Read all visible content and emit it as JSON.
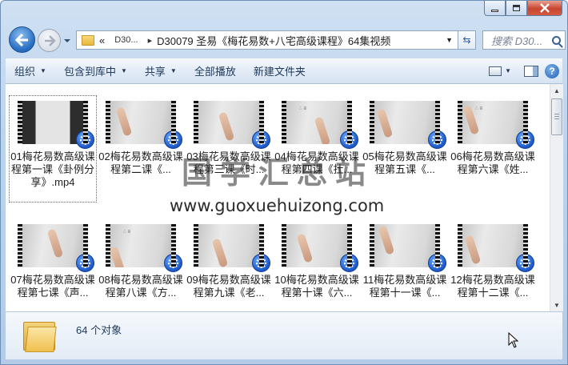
{
  "address": {
    "overflow": "«",
    "crumbs": [
      "D30...",
      "D30079 圣易《梅花易数+八宅高级课程》64集视频"
    ]
  },
  "search": {
    "placeholder": "搜索 D30..."
  },
  "toolbar": {
    "organize": "组织",
    "include_library": "包含到库中",
    "share": "共享",
    "play_all": "全部播放",
    "new_folder": "新建文件夹"
  },
  "files": [
    {
      "name": "01梅花易数高级课程第一课《卦例分享》.mp4",
      "label": "01梅花易数高级课程第一课《卦例分享》.mp4"
    },
    {
      "name": "02",
      "label": "02梅花易数高级课程第二课《..."
    },
    {
      "name": "03",
      "label": "03梅花易数高级课程第三课《时..."
    },
    {
      "name": "04",
      "label": "04梅花易数高级课程第四课《扗..."
    },
    {
      "name": "05",
      "label": "05梅花易数高级课程第五课《..."
    },
    {
      "name": "06",
      "label": "06梅花易数高级课程第六课《姓..."
    },
    {
      "name": "07",
      "label": "07梅花易数高级课程第七课《声..."
    },
    {
      "name": "08",
      "label": "08梅花易数高级课程第八课《方..."
    },
    {
      "name": "09",
      "label": "09梅花易数高级课程第九课《老..."
    },
    {
      "name": "10",
      "label": "10梅花易数高级课程第十课《六..."
    },
    {
      "name": "11",
      "label": "11梅花易数高级课程第十一课《..."
    },
    {
      "name": "12",
      "label": "12梅花易数高级课程第十二课《..."
    }
  ],
  "watermark": {
    "title": "国学汇总站",
    "url": "www.guoxuehuizong.com"
  },
  "status": {
    "count": "64 个对象"
  },
  "icons": {
    "back": "back-arrow-icon",
    "forward": "forward-arrow-icon",
    "help": "help-icon",
    "media": "media-player-icon"
  }
}
